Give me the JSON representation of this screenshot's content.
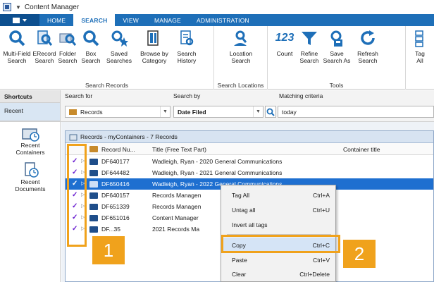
{
  "app": {
    "title": "Content Manager"
  },
  "ribbon_tabs": [
    "HOME",
    "SEARCH",
    "VIEW",
    "MANAGE",
    "ADMINISTRATION"
  ],
  "active_tab": "SEARCH",
  "ribbon": {
    "groups": {
      "search_records": "Search Records",
      "search_locations": "Search Locations",
      "tools": "Tools"
    },
    "buttons": {
      "multifield_1": "Multi-Field",
      "multifield_2": "Search",
      "erecord_1": "ERecord",
      "erecord_2": "Search",
      "folder_1": "Folder",
      "folder_2": "Search",
      "box_1": "Box",
      "box_2": "Search",
      "saved_1": "Saved",
      "saved_2": "Searches",
      "browse_1": "Browse by",
      "browse_2": "Category",
      "history_1": "Search",
      "history_2": "History",
      "location_1": "Location",
      "location_2": "Search",
      "count_1": "Count",
      "count_2": "",
      "refine_1": "Refine",
      "refine_2": "Search",
      "saveas_1": "Save",
      "saveas_2": "Search As",
      "refresh_1": "Refresh",
      "refresh_2": "Search",
      "tagall_1": "Tag",
      "tagall_2": "All"
    },
    "count_glyph": "123"
  },
  "searchbar": {
    "shortcuts": "Shortcuts",
    "recent": "Recent",
    "search_for_label": "Search for",
    "search_for_value": "Records",
    "search_by_label": "Search by",
    "search_by_value": "Date Filed",
    "criteria_label": "Matching criteria",
    "criteria_value": "today"
  },
  "leftnav": {
    "recent_containers_1": "Recent",
    "recent_containers_2": "Containers",
    "recent_documents_1": "Recent",
    "recent_documents_2": "Documents"
  },
  "panel": {
    "title": "Records - myContainers - 7 Records",
    "columns": [
      "Record Nu...",
      "Title (Free Text Part)",
      "Container title"
    ],
    "rows": [
      {
        "num": "DF640177",
        "title": "Wadleigh, Ryan - 2020 General Communications"
      },
      {
        "num": "DF644482",
        "title": "Wadleigh, Ryan - 2021 General Communications"
      },
      {
        "num": "DF650416",
        "title": "Wadleigh, Ryan - 2022 General Communications"
      },
      {
        "num": "DF640157",
        "title": "Records Managen"
      },
      {
        "num": "DF651339",
        "title": "Records Managen"
      },
      {
        "num": "DF651016",
        "title": "Content Manager"
      },
      {
        "num": "DF...35",
        "title": "2021 Records Ma"
      }
    ],
    "tick": "✓"
  },
  "context_menu": {
    "items": [
      {
        "label": "Tag All",
        "shortcut": "Ctrl+A"
      },
      {
        "label": "Untag all",
        "shortcut": "Ctrl+U"
      },
      {
        "label": "Invert all tags",
        "shortcut": ""
      },
      {
        "label": "Copy",
        "shortcut": "Ctrl+C"
      },
      {
        "label": "Paste",
        "shortcut": "Ctrl+V"
      },
      {
        "label": "Clear",
        "shortcut": "Ctrl+Delete"
      }
    ]
  },
  "callouts": {
    "one": "1",
    "two": "2"
  },
  "colors": {
    "accent": "#1e6fb8",
    "callout": "#f0a21c",
    "tick": "#6a1fd1",
    "selected_row": "#1e6fd0"
  }
}
